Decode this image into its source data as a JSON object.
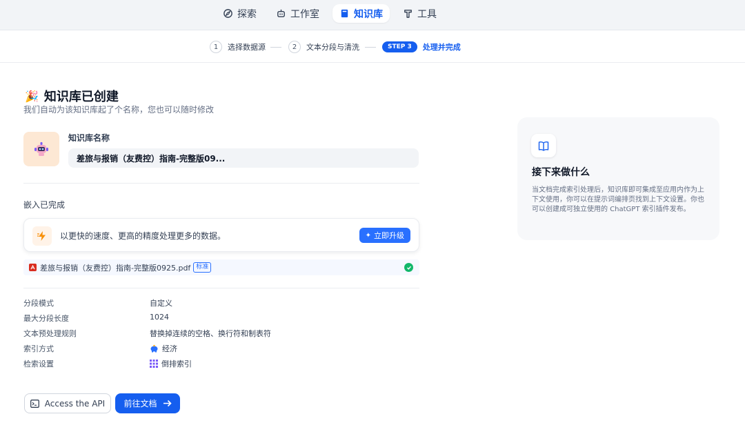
{
  "nav": {
    "items": [
      {
        "label": "探索",
        "icon": "compass-icon"
      },
      {
        "label": "工作室",
        "icon": "robot-icon"
      },
      {
        "label": "知识库",
        "icon": "book-icon",
        "active": true
      },
      {
        "label": "工具",
        "icon": "hammer-icon"
      }
    ]
  },
  "stepper": {
    "steps": [
      {
        "num": "1",
        "label": "选择数据源"
      },
      {
        "num": "2",
        "label": "文本分段与清洗"
      },
      {
        "num": "STEP 3",
        "label": "处理并完成",
        "active": true
      }
    ]
  },
  "header": {
    "emoji": "🎉",
    "title": "知识库已创建",
    "subtitle": "我们自动为该知识库起了个名称，您也可以随时修改"
  },
  "kb": {
    "name_label": "知识库名称",
    "name_value": "差旅与报销（友费控）指南-完整版09..."
  },
  "embed": {
    "title": "嵌入已完成",
    "upgrade_text": "以更快的速度、更高的精度处理更多的数据。",
    "upgrade_button": "立即升级",
    "file_name": "差旅与报销（友费控）指南-完整版0925.pdf",
    "file_badge": "标准"
  },
  "settings": [
    {
      "key": "分段模式",
      "value": "自定义"
    },
    {
      "key": "最大分段长度",
      "value": "1024"
    },
    {
      "key": "文本预处理规则",
      "value": "替换掉连续的空格、换行符和制表符"
    },
    {
      "key": "索引方式",
      "value": "经济",
      "icon": "piggy-bank-icon"
    },
    {
      "key": "检索设置",
      "value": "倒排索引",
      "icon": "grid-icon"
    }
  ],
  "actions": {
    "api_label": "Access the API",
    "docs_label": "前往文档"
  },
  "side": {
    "title": "接下来做什么",
    "text": "当文档完成索引处理后，知识库即可集成至应用内作为上下文使用，你可以在提示词编排页找到上下文设置。你也可以创建成可独立使用的 ChatGPT 索引插件发布。"
  },
  "colors": {
    "accent": "#155eef",
    "success": "#12b76a"
  }
}
